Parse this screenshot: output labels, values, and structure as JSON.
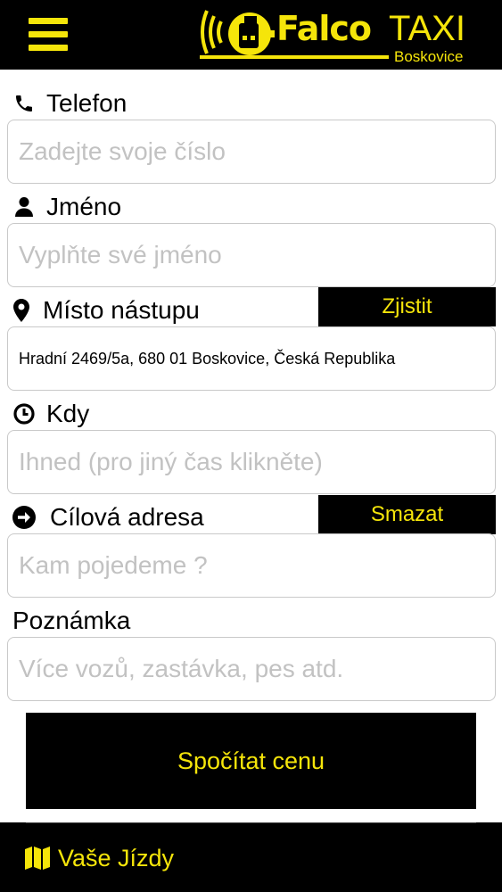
{
  "header": {
    "logo": {
      "brand": "Falco",
      "brand2": "TAXI",
      "city": "Boskovice",
      "badge": "TAXI"
    }
  },
  "form": {
    "phone": {
      "label": "Telefon",
      "placeholder": "Zadejte svoje číslo"
    },
    "name": {
      "label": "Jméno",
      "placeholder": "Vyplňte své jméno"
    },
    "pickup": {
      "label": "Místo nástupu",
      "action": "Zjistit",
      "value": "Hradní 2469/5a, 680 01 Boskovice, Česká Republika"
    },
    "when": {
      "label": "Kdy",
      "placeholder": "Ihned (pro jiný čas klikněte)"
    },
    "destination": {
      "label": "Cílová adresa",
      "action": "Smazat",
      "placeholder": "Kam pojedeme ?"
    },
    "note": {
      "label": "Poznámka",
      "placeholder": "Více vozů, zastávka, pes atd."
    }
  },
  "actions": {
    "calculate": "Spočítat cenu"
  },
  "footer": {
    "rides": "Vaše Jízdy"
  },
  "colors": {
    "accent": "#f5e50a",
    "bar": "#000000",
    "placeholder": "#c2c2c2",
    "border": "#c9c9c9"
  },
  "icons": [
    "menu-icon",
    "phone-icon",
    "user-icon",
    "map-marker-icon",
    "clock-icon",
    "arrow-circle-right-icon",
    "map-icon"
  ]
}
